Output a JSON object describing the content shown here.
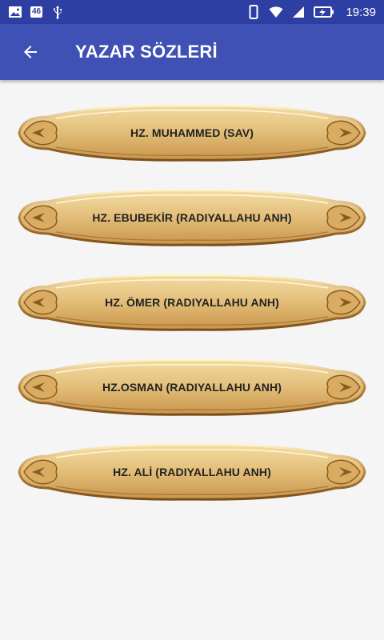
{
  "status_bar": {
    "time": "19:39",
    "badge": "46",
    "icons": [
      "image-icon",
      "network-badge-icon",
      "usb-icon",
      "phone-icon",
      "wifi-icon",
      "signal-icon",
      "battery-charging-icon"
    ]
  },
  "app_bar": {
    "title": "YAZAR SÖZLERİ",
    "back_icon": "arrow-back-icon",
    "color": "#3f51b5"
  },
  "items": [
    {
      "label": "HZ. MUHAMMED (SAV)"
    },
    {
      "label": "HZ. EBUBEKİR (RADIYALLAHU ANH)"
    },
    {
      "label": "HZ. ÖMER (RADIYALLAHU ANH)"
    },
    {
      "label": "HZ.OSMAN (RADIYALLAHU ANH)"
    },
    {
      "label": "HZ. ALİ (RADIYALLAHU ANH)"
    }
  ]
}
